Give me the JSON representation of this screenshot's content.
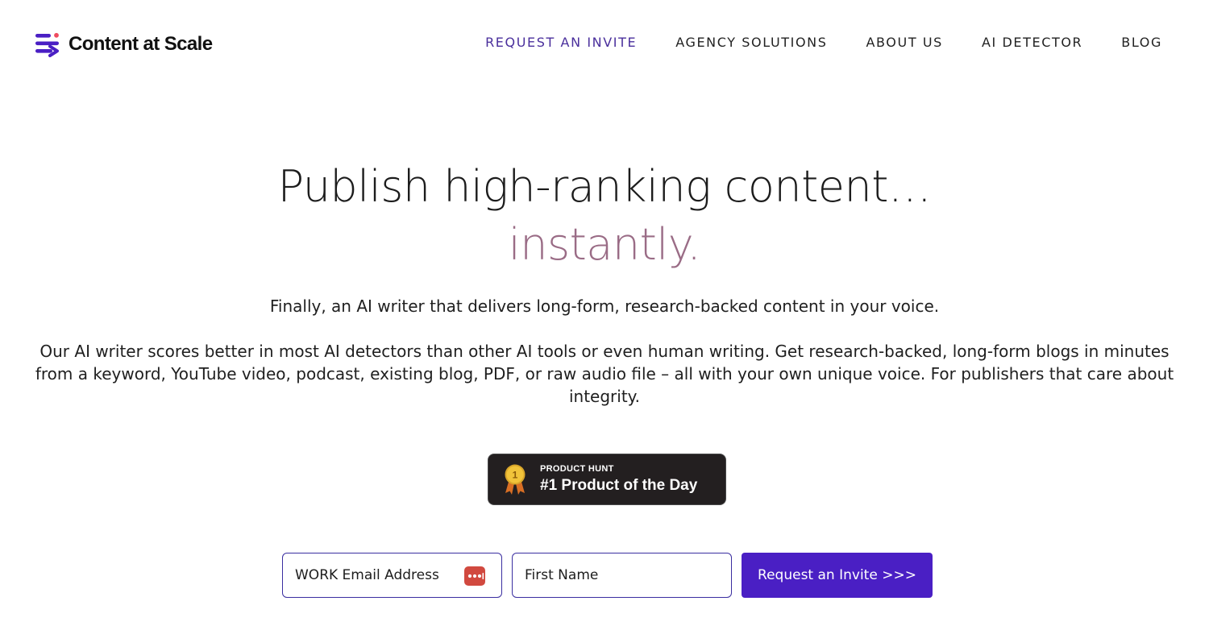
{
  "brand": {
    "name": "Content at Scale",
    "accent_color": "#4a1fc4",
    "logo_icon": "stacked-lines-arrow-icon"
  },
  "nav": {
    "items": [
      {
        "label": "REQUEST AN INVITE",
        "active": true
      },
      {
        "label": "AGENCY SOLUTIONS",
        "active": false
      },
      {
        "label": "ABOUT US",
        "active": false
      },
      {
        "label": "AI DETECTOR",
        "active": false
      },
      {
        "label": "BLOG",
        "active": false
      }
    ],
    "active_color": "#4a2f9c"
  },
  "hero": {
    "title": "Publish high-ranking content…",
    "accent_word": "instantly.",
    "accent_color": "#9a6c86",
    "lead": "Finally, an AI writer that delivers long-form, research-backed content in your voice.",
    "body": "Our AI writer scores better in most AI detectors than other AI tools or even human writing. Get research-backed, long-form blogs in minutes from a keyword, YouTube video, podcast, existing blog, PDF, or raw audio file – all with your own unique voice. For publishers that care about integrity."
  },
  "badge": {
    "kicker": "PRODUCT HUNT",
    "main": "#1 Product of the Day",
    "medal_number": "1",
    "medal_icon": "medal-icon"
  },
  "form": {
    "email_placeholder": "WORK Email Address",
    "first_name_placeholder": "First Name",
    "submit_label": "Request an Invite >>>",
    "password_manager_icon": "password-dots-icon"
  }
}
